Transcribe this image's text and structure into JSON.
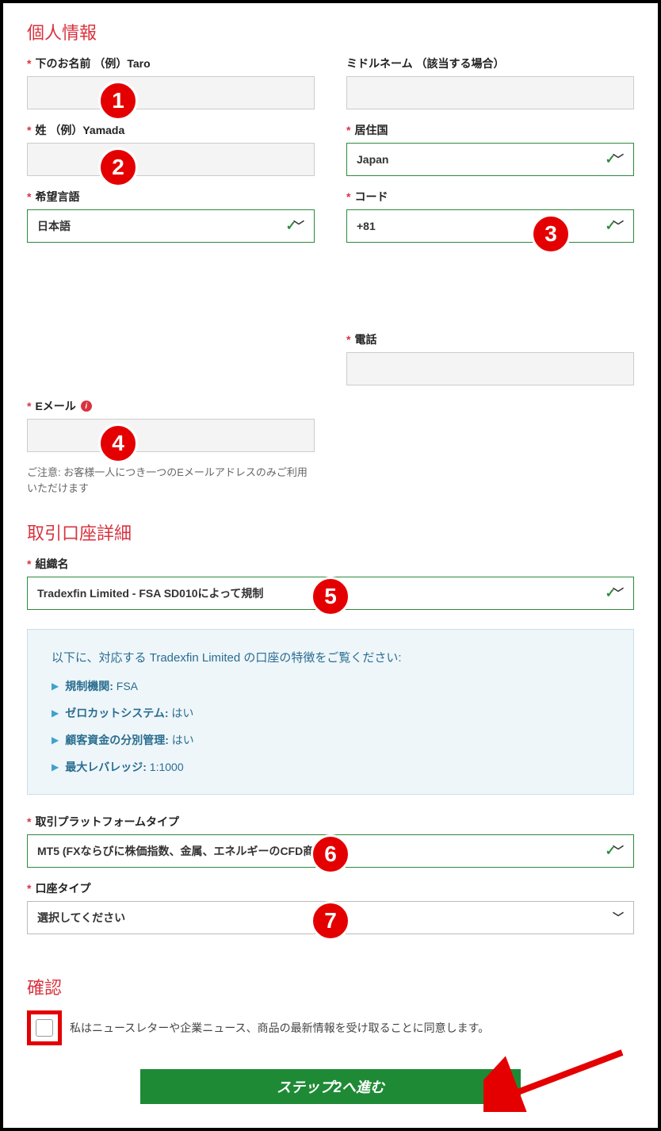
{
  "sections": {
    "personal": "個人情報",
    "account": "取引口座詳細",
    "confirm": "確認"
  },
  "labels": {
    "first_name": "下のお名前 （例）Taro",
    "middle_name": "ミドルネーム （該当する場合）",
    "last_name": "姓 （例）Yamada",
    "country": "居住国",
    "language": "希望言語",
    "code": "コード",
    "phone": "電話",
    "email": "Eメール",
    "organization": "組織名",
    "platform": "取引プラットフォームタイプ",
    "account_type": "口座タイプ"
  },
  "values": {
    "country": "Japan",
    "language": "日本語",
    "code": "+81",
    "organization": "Tradexfin Limited - FSA SD010によって規制",
    "platform": "MT5 (FXならびに株価指数、金属、エネルギーのCFD商品)",
    "account_type": "選択してください"
  },
  "email_note": "ご注意: お客様一人につき一つのEメールアドレスのみご利用いただけます",
  "info_box": {
    "title": "以下に、対応する Tradexfin Limited の口座の特徴をご覧ください:",
    "items": [
      {
        "key": "規制機関:",
        "val": "FSA"
      },
      {
        "key": "ゼロカットシステム:",
        "val": "はい"
      },
      {
        "key": "顧客資金の分別管理:",
        "val": "はい"
      },
      {
        "key": "最大レバレッジ:",
        "val": "1:1000"
      }
    ]
  },
  "confirm_text": "私はニュースレターや企業ニュース、商品の最新情報を受け取ることに同意します。",
  "submit": "ステップ2へ進む",
  "badges": [
    "1",
    "2",
    "3",
    "4",
    "5",
    "6",
    "7"
  ]
}
